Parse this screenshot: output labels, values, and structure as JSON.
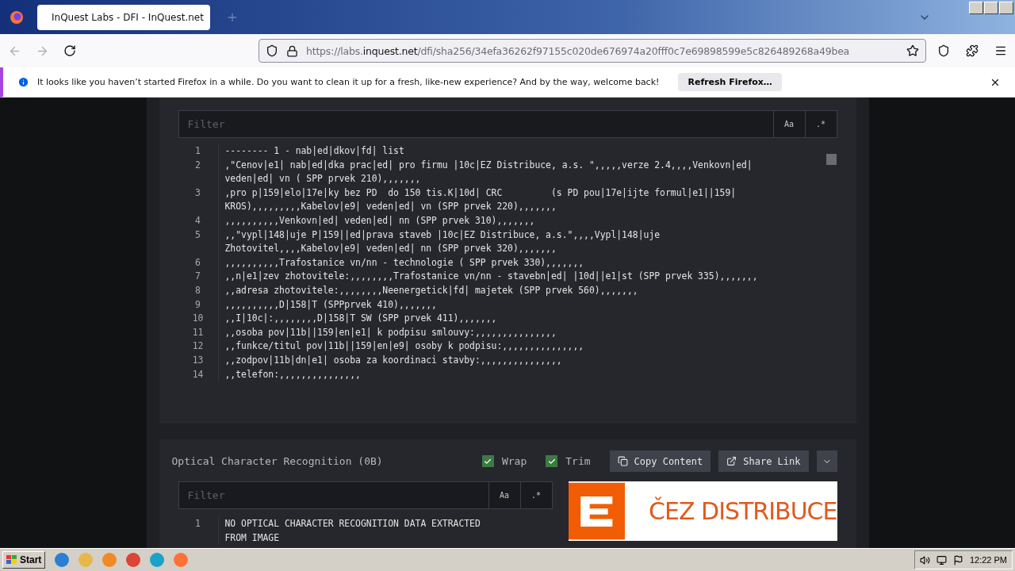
{
  "browser": {
    "tab_title": "InQuest Labs - DFI - InQuest.net",
    "url_prefix": "https://labs.",
    "url_domain": "inquest.net",
    "url_path": "/dfi/sha256/34efa36262f97155c020de676974a20fff0c7e69898599e5c826489268a49bea"
  },
  "notification": {
    "message": "It looks like you haven’t started Firefox in a while. Do you want to clean it up for a fresh, like-new experience? And by the way, welcome back!",
    "button": "Refresh Firefox…"
  },
  "text_panel": {
    "filter_placeholder": "Filter",
    "case_button": "Aa",
    "regex_button": ".*",
    "lines": [
      {
        "number": "1",
        "text": "-------- 1 - nab|ed|dkov|fd| list"
      },
      {
        "number": "2",
        "text": ",\"Cenov|e1| nab|ed|dka prac|ed| pro firmu |10c|EZ Distribuce, a.s. \",,,,,verze 2.4,,,,Venkovn|ed| veden|ed| vn ( SPP prvek 210),,,,,,,"
      },
      {
        "number": "3",
        "text": ",pro p|159|elo|17e|ky bez PD  do 150 tis.K|10d| CRC         (s PD pou|17e|ijte formul|e1||159| KROS),,,,,,,,,Kabelov|e9| veden|ed| vn (SPP prvek 220),,,,,,,"
      },
      {
        "number": "4",
        "text": ",,,,,,,,,,Venkovn|ed| veden|ed| nn (SPP prvek 310),,,,,,,"
      },
      {
        "number": "5",
        "text": ",,\"vypl|148|uje P|159||ed|prava staveb |10c|EZ Distribuce, a.s.\",,,,Vypl|148|uje Zhotovitel,,,,Kabelov|e9| veden|ed| nn (SPP prvek 320),,,,,,,"
      },
      {
        "number": "6",
        "text": ",,,,,,,,,,Trafostanice vn/nn - technologie ( SPP prvek 330),,,,,,,"
      },
      {
        "number": "7",
        "text": ",,n|e1|zev zhotovitele:,,,,,,,,Trafostanice vn/nn - stavebn|ed| |10d||e1|st (SPP prvek 335),,,,,,,"
      },
      {
        "number": "8",
        "text": ",,adresa zhotovitele:,,,,,,,,Neenergetick|fd| majetek (SPP prvek 560),,,,,,,"
      },
      {
        "number": "9",
        "text": ",,,,,,,,,,D|158|T (SPPprvek 410),,,,,,,"
      },
      {
        "number": "10",
        "text": ",,I|10c|:,,,,,,,,D|158|T SW (SPP prvek 411),,,,,,,"
      },
      {
        "number": "11",
        "text": ",,osoba pov|11b||159|en|e1| k podpisu smlouvy:,,,,,,,,,,,,,,,"
      },
      {
        "number": "12",
        "text": ",,funkce/titul pov|11b||159|en|e9| osoby k podpisu:,,,,,,,,,,,,,,,"
      },
      {
        "number": "13",
        "text": ",,zodpov|11b|dn|e1| osoba za koordinaci stavby:,,,,,,,,,,,,,,,"
      },
      {
        "number": "14",
        "text": ",,telefon:,,,,,,,,,,,,,,,"
      }
    ]
  },
  "ocr_panel": {
    "title": "Optical Character Recognition (0B)",
    "wrap": {
      "label": "Wrap",
      "checked": true
    },
    "trim": {
      "label": "Trim",
      "checked": true
    },
    "copy_button": "Copy Content",
    "share_button": "Share Link",
    "filter_placeholder": "Filter",
    "case_button": "Aa",
    "regex_button": ".*",
    "lines": [
      {
        "number": "1",
        "text": "NO OPTICAL CHARACTER RECOGNITION DATA EXTRACTED FROM IMAGE"
      }
    ],
    "image_text": "ČEZ DISTRIBUCE"
  },
  "taskbar": {
    "start": "Start",
    "clock": "12:22 PM"
  }
}
